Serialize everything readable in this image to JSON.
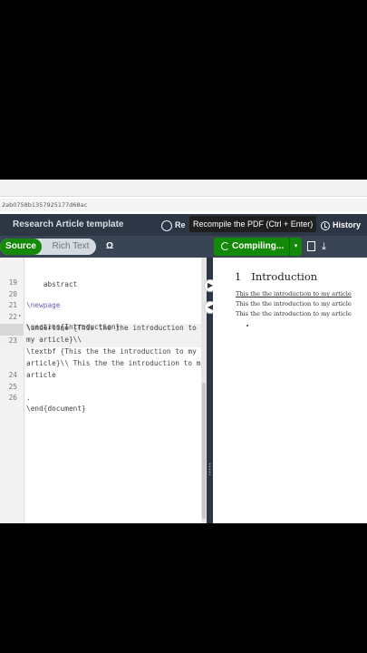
{
  "browser": {
    "address": "2ab0758b1357925177d68ac"
  },
  "header": {
    "project_title": "Research Article template",
    "review_label": "Re",
    "tooltip": "Recompile the PDF (Ctrl + Enter)",
    "history_label": "History"
  },
  "toolbar": {
    "source_label": "Source",
    "rich_text_label": "Rich Text",
    "symbol_label": "Ω",
    "compile_label": "Compiling...",
    "compile_dropdown": "▾",
    "download_icon": "⤓"
  },
  "editor": {
    "lines": [
      {
        "num": "",
        "text": "    abstract"
      },
      {
        "num": "19",
        "text": ""
      },
      {
        "num": "20",
        "text": "\\newpage"
      },
      {
        "num": "21",
        "marker": "▾",
        "text": "\\section{Introduction}"
      },
      {
        "num": "22",
        "text": "\\underline {This the the introduction to"
      },
      {
        "num": "",
        "text": "my article}\\\\"
      },
      {
        "num": "23",
        "text": "\\textbf {This the the introduction to my"
      },
      {
        "num": "",
        "text": "article}\\\\ This the the introduction to my"
      },
      {
        "num": "",
        "text": "article"
      },
      {
        "num": "24",
        "text": ""
      },
      {
        "num": "25",
        "text": "."
      },
      {
        "num": "26",
        "text": "\\end{document}"
      }
    ]
  },
  "pdf": {
    "section_number": "1",
    "section_title": "Introduction",
    "paragraph": [
      "This the the introduction to my article",
      "This the the introduction to my article",
      "This the the introduction to my article"
    ]
  },
  "colors": {
    "brand_green": "#138a07",
    "header_bg": "#2c3645",
    "toolbar_bg": "#394554"
  }
}
